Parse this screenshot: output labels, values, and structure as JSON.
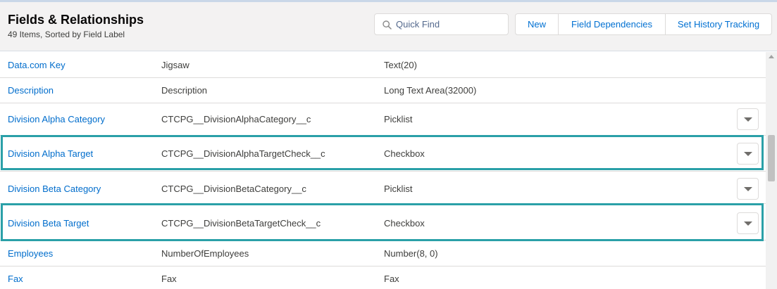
{
  "header": {
    "title": "Fields & Relationships",
    "subtitle": "49 Items, Sorted by Field Label",
    "search_placeholder": "Quick Find",
    "buttons": {
      "new": "New",
      "field_dependencies": "Field Dependencies",
      "history_tracking": "Set History Tracking"
    }
  },
  "rows": [
    {
      "label": "Data.com Key",
      "api": "Jigsaw",
      "type": "Text(20)",
      "has_menu": false,
      "highlighted": false
    },
    {
      "label": "Description",
      "api": "Description",
      "type": "Long Text Area(32000)",
      "has_menu": false,
      "highlighted": false
    },
    {
      "label": "Division Alpha Category",
      "api": "CTCPG__DivisionAlphaCategory__c",
      "type": "Picklist",
      "has_menu": true,
      "highlighted": false
    },
    {
      "label": "Division Alpha Target",
      "api": "CTCPG__DivisionAlphaTargetCheck__c",
      "type": "Checkbox",
      "has_menu": true,
      "highlighted": true
    },
    {
      "label": "Division Beta Category",
      "api": "CTCPG__DivisionBetaCategory__c",
      "type": "Picklist",
      "has_menu": true,
      "highlighted": false
    },
    {
      "label": "Division Beta Target",
      "api": "CTCPG__DivisionBetaTargetCheck__c",
      "type": "Checkbox",
      "has_menu": true,
      "highlighted": true
    },
    {
      "label": "Employees",
      "api": "NumberOfEmployees",
      "type": "Number(8, 0)",
      "has_menu": false,
      "highlighted": false
    },
    {
      "label": "Fax",
      "api": "Fax",
      "type": "Fax",
      "has_menu": false,
      "highlighted": false
    }
  ],
  "colors": {
    "link": "#006dcc",
    "highlight_border": "#2aa0a8",
    "header_bg": "#f3f2f2"
  },
  "icons": {
    "search": "search-icon",
    "row_menu": "chevron-down-icon"
  }
}
